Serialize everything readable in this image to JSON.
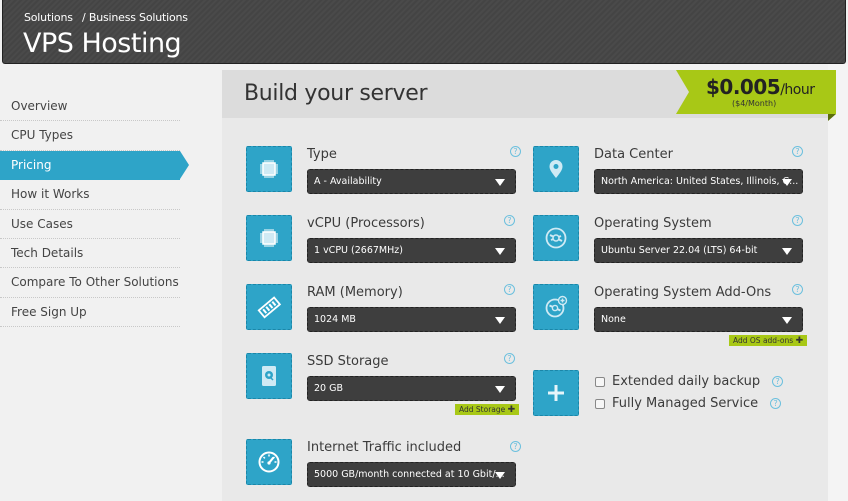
{
  "header": {
    "breadcrumb": [
      "Solutions",
      "/ Business Solutions"
    ],
    "title": "VPS Hosting"
  },
  "sidebar": {
    "items": [
      {
        "label": "Overview",
        "active": false
      },
      {
        "label": "CPU Types",
        "active": false
      },
      {
        "label": "Pricing",
        "active": true
      },
      {
        "label": "How it Works",
        "active": false
      },
      {
        "label": "Use Cases",
        "active": false
      },
      {
        "label": "Tech Details",
        "active": false
      },
      {
        "label": "Compare To Other Solutions",
        "active": false
      },
      {
        "label": "Free Sign Up",
        "active": false
      }
    ]
  },
  "panel": {
    "title": "Build your server"
  },
  "price": {
    "amount": "$0.005",
    "unit": "/hour",
    "monthly": "($4/Month)"
  },
  "options": {
    "type": {
      "label": "Type",
      "value": "A - Availability",
      "icon": "cpu-chip-icon"
    },
    "vcpu": {
      "label": "vCPU (Processors)",
      "value": "1 vCPU (2667MHz)",
      "icon": "cpu-chip-icon"
    },
    "ram": {
      "label": "RAM (Memory)",
      "value": "1024 MB",
      "icon": "memory-stick-icon"
    },
    "ssd": {
      "label": "SSD Storage",
      "value": "20 GB",
      "icon": "hard-drive-icon",
      "add_label": "Add Storage"
    },
    "traffic": {
      "label": "Internet Traffic included",
      "value": "5000 GB/month connected at 10 Gbit/...",
      "icon": "speedometer-icon"
    },
    "datacenter": {
      "label": "Data Center",
      "value": "North America: United States, Illinois, C...",
      "icon": "map-pin-icon"
    },
    "os": {
      "label": "Operating System",
      "value": "Ubuntu Server 22.04 (LTS) 64-bit",
      "icon": "disc-icon"
    },
    "os_addons": {
      "label": "Operating System Add-Ons",
      "value": "None",
      "icon": "disc-plus-icon",
      "add_label": "Add OS add-ons"
    },
    "extras": {
      "icon": "plus-icon",
      "checkboxes": [
        {
          "label": "Extended daily backup",
          "checked": false
        },
        {
          "label": "Fully Managed Service",
          "checked": false
        }
      ]
    }
  },
  "colors": {
    "accent_blue": "#2ea4c8",
    "accent_green": "#a8c816",
    "select_bg": "#3e3e3e",
    "header_bg": "#474747"
  }
}
